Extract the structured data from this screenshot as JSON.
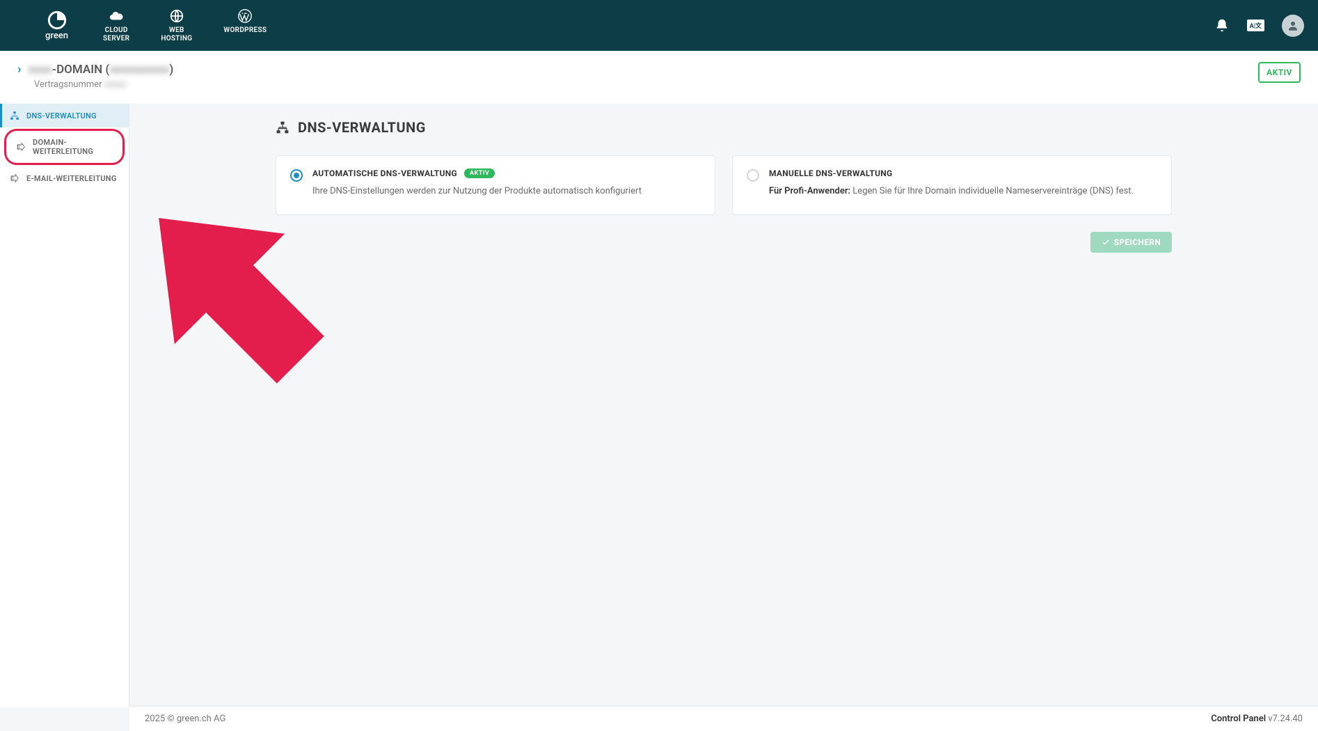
{
  "header": {
    "logo_text": "green",
    "nav": [
      {
        "label": "CLOUD\nSERVER"
      },
      {
        "label": "WEB\nHOSTING"
      },
      {
        "label": "WORDPRESS"
      }
    ],
    "lang_badge": "A|文"
  },
  "breadcrumb": {
    "title_prefix": "-DOMAIN (",
    "title_suffix": ")",
    "subtitle": "Vertragsnummer",
    "status": "AKTIV"
  },
  "sidebar": {
    "items": [
      {
        "label": "DNS-VERWALTUNG",
        "active": true
      },
      {
        "label": "DOMAIN-WEITERLEITUNG",
        "highlighted": true
      },
      {
        "label": "E-MAIL-WEITERLEITUNG"
      }
    ]
  },
  "content": {
    "title": "DNS-VERWALTUNG",
    "cards": {
      "auto": {
        "title": "AUTOMATISCHE DNS-VERWALTUNG",
        "badge": "AKTIV",
        "desc": "Ihre DNS-Einstellungen werden zur Nutzung der Produkte automatisch konfiguriert"
      },
      "manual": {
        "title": "MANUELLE DNS-VERWALTUNG",
        "desc_bold": "Für Profi-Anwender:",
        "desc_rest": " Legen Sie für Ihre Domain individuelle Nameservereinträge (DNS) fest."
      }
    },
    "save_label": "SPEICHERN"
  },
  "footer": {
    "left": "2025 © green.ch AG",
    "right_label": "Control Panel",
    "right_version": " v7.24.40"
  }
}
